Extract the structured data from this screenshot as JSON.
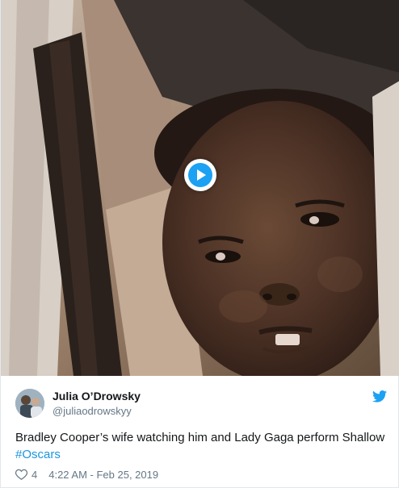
{
  "media": {
    "type": "video",
    "play_icon": "play-icon"
  },
  "author": {
    "name": "Julia O’Drowsky",
    "handle": "@juliaodrowskyy"
  },
  "tweet": {
    "text_part1": "Bradley Cooper’s wife watching him and Lady Gaga perform Shallow ",
    "hashtag": "#Oscars"
  },
  "footer": {
    "like_count": "4",
    "timestamp": "4:22 AM - Feb 25, 2019"
  },
  "icons": {
    "brand": "twitter-bird-icon",
    "like": "heart-icon"
  },
  "colors": {
    "accent": "#1da1f2",
    "hashtag": "#1b95e0",
    "text": "#14171a",
    "muted": "#657786"
  }
}
